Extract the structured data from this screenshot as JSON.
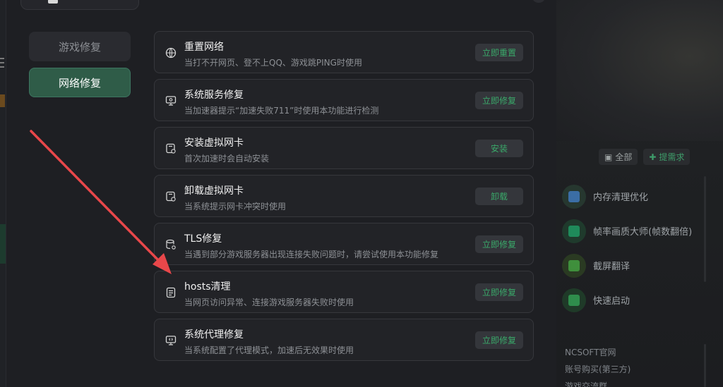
{
  "background": {
    "filter_all": "全部",
    "filter_request": "提需求",
    "tools": [
      {
        "label": "内存清理优化",
        "icon": "memory-clean-icon",
        "color": "#3b6ea5"
      },
      {
        "label": "帧率画质大师(帧数翻倍)",
        "icon": "framerate-icon",
        "color": "#1f8a5a"
      },
      {
        "label": "截屏翻译",
        "icon": "screenshot-translate-icon",
        "color": "#3f8f3c"
      },
      {
        "label": "快速启动",
        "icon": "quick-launch-icon",
        "color": "#2f8d4c"
      }
    ],
    "links": [
      "NCSOFT官网",
      "账号购买(第三方)",
      "游戏交流群"
    ]
  },
  "nav": {
    "items": [
      {
        "label": "游戏修复",
        "active": false
      },
      {
        "label": "网络修复",
        "active": true
      }
    ]
  },
  "repairs": [
    {
      "title": "重置网络",
      "desc": "当打不开网页、登不上QQ、游戏跳PING时使用",
      "action": "立即重置",
      "icon": "globe-reset-icon"
    },
    {
      "title": "系统服务修复",
      "desc": "当加速器提示“加速失败711”时使用本功能进行检测",
      "action": "立即修复",
      "icon": "monitor-service-icon"
    },
    {
      "title": "安装虚拟网卡",
      "desc": "首次加速时会自动安装",
      "action": "安装",
      "icon": "network-card-install-icon"
    },
    {
      "title": "卸载虚拟网卡",
      "desc": "当系统提示网卡冲突时使用",
      "action": "卸载",
      "icon": "network-card-uninstall-icon"
    },
    {
      "title": "TLS修复",
      "desc": "当遇到部分游戏服务器出现连接失败问题时，请尝试使用本功能修复",
      "action": "立即修复",
      "icon": "database-gear-icon"
    },
    {
      "title": "hosts清理",
      "desc": "当网页访问异常、连接游戏服务器失败时使用",
      "action": "立即修复",
      "icon": "hosts-file-icon"
    },
    {
      "title": "系统代理修复",
      "desc": "当系统配置了代理模式，加速后无效果时使用",
      "action": "立即修复",
      "icon": "proxy-monitor-icon"
    }
  ],
  "colors": {
    "accent": "#3aa96a",
    "annotation_arrow": "#e8474a"
  }
}
